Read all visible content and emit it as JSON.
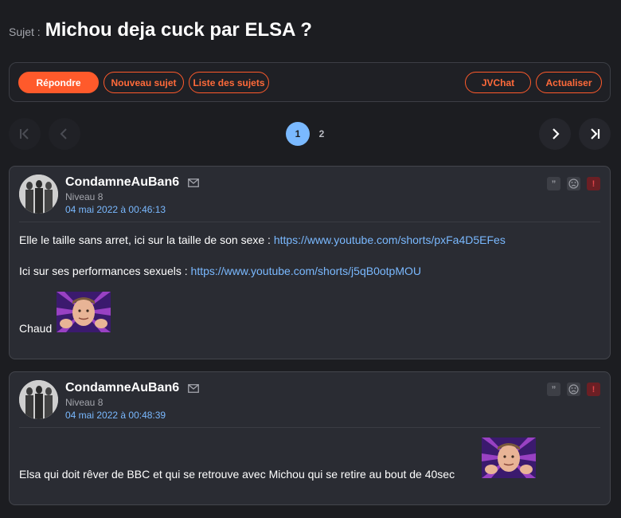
{
  "topic": {
    "prefix": "Sujet :",
    "title": "Michou deja cuck par ELSA ?"
  },
  "toolbar": {
    "reply": "Répondre",
    "new_topic": "Nouveau sujet",
    "topic_list": "Liste des sujets",
    "jvchat": "JVChat",
    "refresh": "Actualiser"
  },
  "pagination": {
    "pages": [
      "1",
      "2"
    ],
    "current": "1"
  },
  "posts": [
    {
      "author": "CondamneAuBan6",
      "level": "Niveau 8",
      "date": "04 mai 2022 à 00:46:13",
      "line1_text": "Elle le taille sans arret, ici sur la taille de son sexe : ",
      "line1_link": "https://www.youtube.com/shorts/pxFa4D5EFes",
      "line2_text": "Ici sur ses performances sexuels : ",
      "line2_link": "https://www.youtube.com/shorts/j5qB0otpMOU",
      "line3_text": "Chaud"
    },
    {
      "author": "CondamneAuBan6",
      "level": "Niveau 8",
      "date": "04 mai 2022 à 00:48:39",
      "line1_text": "Elsa qui doit rêver de BBC et qui se retrouve avec Michou qui se retire au bout de 40sec"
    }
  ],
  "colors": {
    "background": "#1c1d21",
    "post_background": "#2a2c33",
    "accent": "#ff5a2b",
    "link": "#7ab9ff",
    "alert": "#e0454b"
  },
  "icons": {
    "mail": "mail-icon",
    "quote": "quote-icon",
    "sad": "sad-face-icon",
    "report": "report-icon",
    "first": "first-page-icon",
    "prev": "previous-page-icon",
    "next": "next-page-icon",
    "last": "last-page-icon"
  }
}
